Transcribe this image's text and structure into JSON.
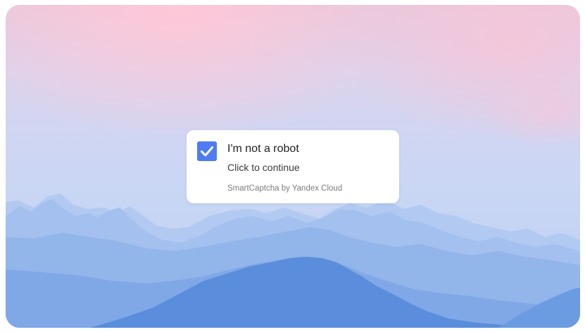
{
  "captcha": {
    "title": "I'm not a robot",
    "subtitle": "Click to continue",
    "provider": "SmartCaptcha by Yandex Cloud",
    "checked": true,
    "checkbox_icon": "checkmark-icon",
    "accent_color": "#4f7cf0"
  },
  "background": {
    "scene": "mountain-landscape",
    "sky_colors": [
      "#f3c2d4",
      "#d7d4ef",
      "#c8d6f4"
    ],
    "mountain_colors": [
      "#a9c4ee",
      "#93b6ea",
      "#6f9ce0",
      "#4f83d6"
    ]
  }
}
